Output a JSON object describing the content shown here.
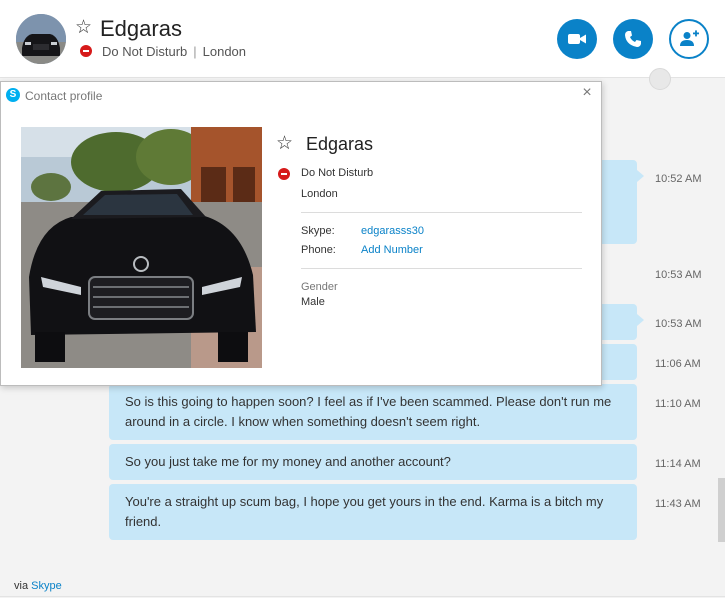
{
  "header": {
    "contact_name": "Edgaras",
    "status": "Do Not Disturb",
    "separator": "|",
    "location": "London",
    "actions": {
      "video_call": "video-call",
      "voice_call": "voice-call",
      "add_contact": "add-people"
    }
  },
  "messages": [
    {
      "text": "",
      "time": "10:52 AM"
    },
    {
      "text": "",
      "time": "10:53 AM"
    },
    {
      "text": "",
      "time": "10:53 AM"
    },
    {
      "text": "",
      "time": "11:06 AM"
    },
    {
      "text": "So is this going to happen soon? I feel as if I've been scammed. Please don't run me around in a circle. I know when something doesn't seem right.",
      "time": "11:10 AM"
    },
    {
      "text": "So you just take me for my money and another account?",
      "time": "11:14 AM"
    },
    {
      "text": "You're a straight up scum bag, I hope you get yours in the end. Karma is a bitch my friend.",
      "time": "11:43 AM"
    }
  ],
  "footer": {
    "prefix": "via ",
    "link": "Skype"
  },
  "profile_popup": {
    "title": "Contact profile",
    "close": "×",
    "name": "Edgaras",
    "status": "Do Not Disturb",
    "location": "London",
    "skype_label": "Skype:",
    "skype_value": "edgarasss30",
    "phone_label": "Phone:",
    "phone_action": "Add Number",
    "gender_label": "Gender",
    "gender_value": "Male"
  },
  "colors": {
    "accent": "#0a82c8",
    "bubble": "#c7e7f8",
    "dnd": "#d61a1a"
  }
}
